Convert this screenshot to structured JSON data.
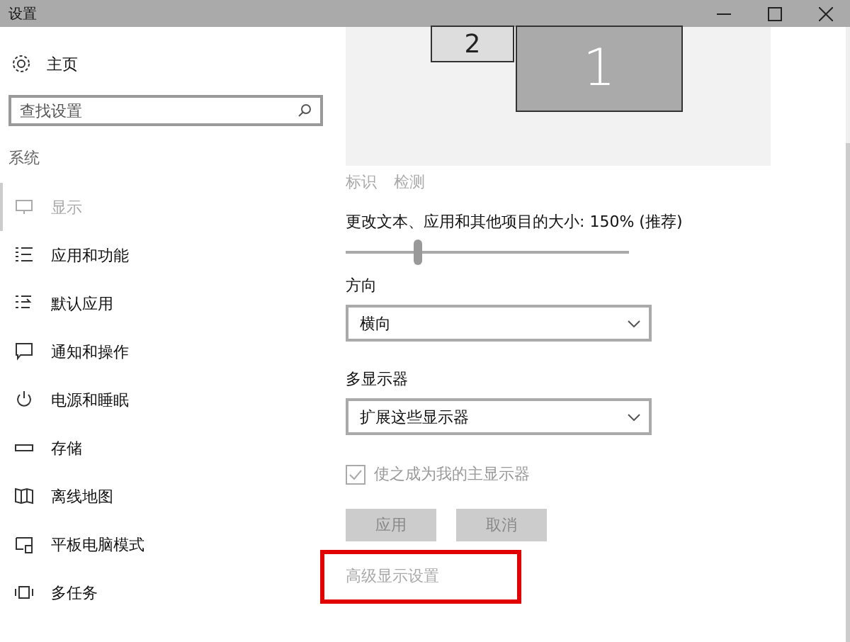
{
  "window": {
    "title": "设置"
  },
  "sidebar": {
    "home": "主页",
    "search": {
      "placeholder": "查找设置"
    },
    "section": "系统",
    "items": [
      {
        "label": "显示",
        "kind": "monitor",
        "selected": true
      },
      {
        "label": "应用和功能",
        "kind": "list",
        "selected": false
      },
      {
        "label": "默认应用",
        "kind": "defaults",
        "selected": false
      },
      {
        "label": "通知和操作",
        "kind": "message",
        "selected": false
      },
      {
        "label": "电源和睡眠",
        "kind": "power",
        "selected": false
      },
      {
        "label": "存储",
        "kind": "storage",
        "selected": false
      },
      {
        "label": "离线地图",
        "kind": "map",
        "selected": false
      },
      {
        "label": "平板电脑模式",
        "kind": "tablet",
        "selected": false
      },
      {
        "label": "多任务",
        "kind": "multitask",
        "selected": false
      }
    ]
  },
  "content": {
    "monitors": [
      {
        "label": "2",
        "selected": false
      },
      {
        "label": "1",
        "selected": true
      }
    ],
    "links": [
      {
        "label": "标识",
        "disabled": true
      },
      {
        "label": "检测",
        "disabled": true
      }
    ],
    "scale": {
      "label": "更改文本、应用和其他项目的大小: 150% (推荐)",
      "level": 0.255
    },
    "orientation": {
      "label": "方向",
      "value": "横向"
    },
    "multi_display": {
      "label": "多显示器",
      "value": "扩展这些显示器"
    },
    "main_display": {
      "label": "使之成为我的主显示器",
      "checked": true,
      "disabled": true
    },
    "buttons": [
      {
        "label": "应用",
        "disabled": true
      },
      {
        "label": "取消",
        "disabled": true
      }
    ],
    "advanced": {
      "label": "高级显示设置",
      "disabled": true,
      "highlighted": true
    }
  }
}
